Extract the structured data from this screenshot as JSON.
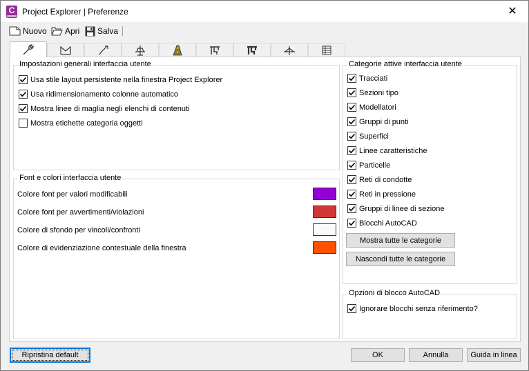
{
  "window": {
    "title": "Project Explorer | Preferenze",
    "app_icon_letter": "C",
    "close_glyph": "✕"
  },
  "toolbar": {
    "new_label": "Nuovo",
    "open_label": "Apri",
    "save_label": "Salva"
  },
  "tabs": [
    {
      "icon": "wrench-icon",
      "active": true
    },
    {
      "icon": "alignment-icon"
    },
    {
      "icon": "profile-icon"
    },
    {
      "icon": "assembly-icon"
    },
    {
      "icon": "corridor-icon"
    },
    {
      "icon": "pipe-network-icon"
    },
    {
      "icon": "pressure-network-icon"
    },
    {
      "icon": "section-icon"
    },
    {
      "icon": "table-icon"
    }
  ],
  "general": {
    "title": "Impostazioni generali interfaccia utente",
    "options": [
      {
        "label": "Usa stile layout persistente nella finestra Project Explorer",
        "checked": true
      },
      {
        "label": "Usa ridimensionamento colonne automatico",
        "checked": true
      },
      {
        "label": "Mostra linee di maglia negli elenchi di contenuti",
        "checked": true
      },
      {
        "label": "Mostra etichette categoria oggetti",
        "checked": false
      }
    ]
  },
  "fonts": {
    "title": "Font e colori interfaccia utente",
    "rows": [
      {
        "label": "Colore font per valori modificabili",
        "color": "#9400d3"
      },
      {
        "label": "Colore font per avvertimenti/violazioni",
        "color": "#d23535"
      },
      {
        "label": "Colore di sfondo per vincoli/confronti",
        "color": "#fafafa"
      },
      {
        "label": "Colore di evidenziazione contestuale della finestra",
        "color": "#ff5000"
      }
    ]
  },
  "categories": {
    "title": "Categorie attive interfaccia utente",
    "items": [
      {
        "label": "Tracciati",
        "checked": true
      },
      {
        "label": "Sezioni tipo",
        "checked": true
      },
      {
        "label": "Modellatori",
        "checked": true
      },
      {
        "label": "Gruppi di punti",
        "checked": true
      },
      {
        "label": "Superfici",
        "checked": true
      },
      {
        "label": "Linee caratteristiche",
        "checked": true
      },
      {
        "label": "Particelle",
        "checked": true
      },
      {
        "label": "Reti di condotte",
        "checked": true
      },
      {
        "label": "Reti in pressione",
        "checked": true
      },
      {
        "label": "Gruppi di linee di sezione",
        "checked": true
      },
      {
        "label": "Blocchi AutoCAD",
        "checked": true
      }
    ],
    "show_all_label": "Mostra tutte le categorie",
    "hide_all_label": "Nascondi tutte le categorie"
  },
  "blocks": {
    "title": "Opzioni di blocco AutoCAD",
    "option": {
      "label": "Ignorare blocchi senza riferimento?",
      "checked": true
    }
  },
  "footer": {
    "reset_label": "Ripristina default",
    "ok_label": "OK",
    "cancel_label": "Annulla",
    "help_label": "Guida in linea"
  }
}
